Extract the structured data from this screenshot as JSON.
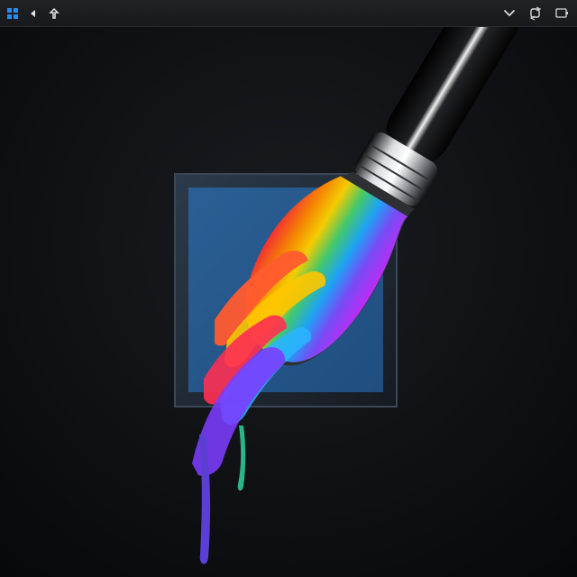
{
  "window": {
    "icons": {
      "start": "windows-icon",
      "back": "back-icon",
      "pin": "pin-icon",
      "collapse": "chevron-down-icon",
      "refresh": "refresh-icon",
      "restore": "window-restore-icon"
    }
  },
  "theme": {
    "background": "#0b0c0f",
    "titlebar": "#1e2023",
    "frame": "#2a3442",
    "canvas_blue": "#2f6aa4",
    "brush_black": "#0a0a0b",
    "ferrule_silver": "#c9cdd2"
  }
}
